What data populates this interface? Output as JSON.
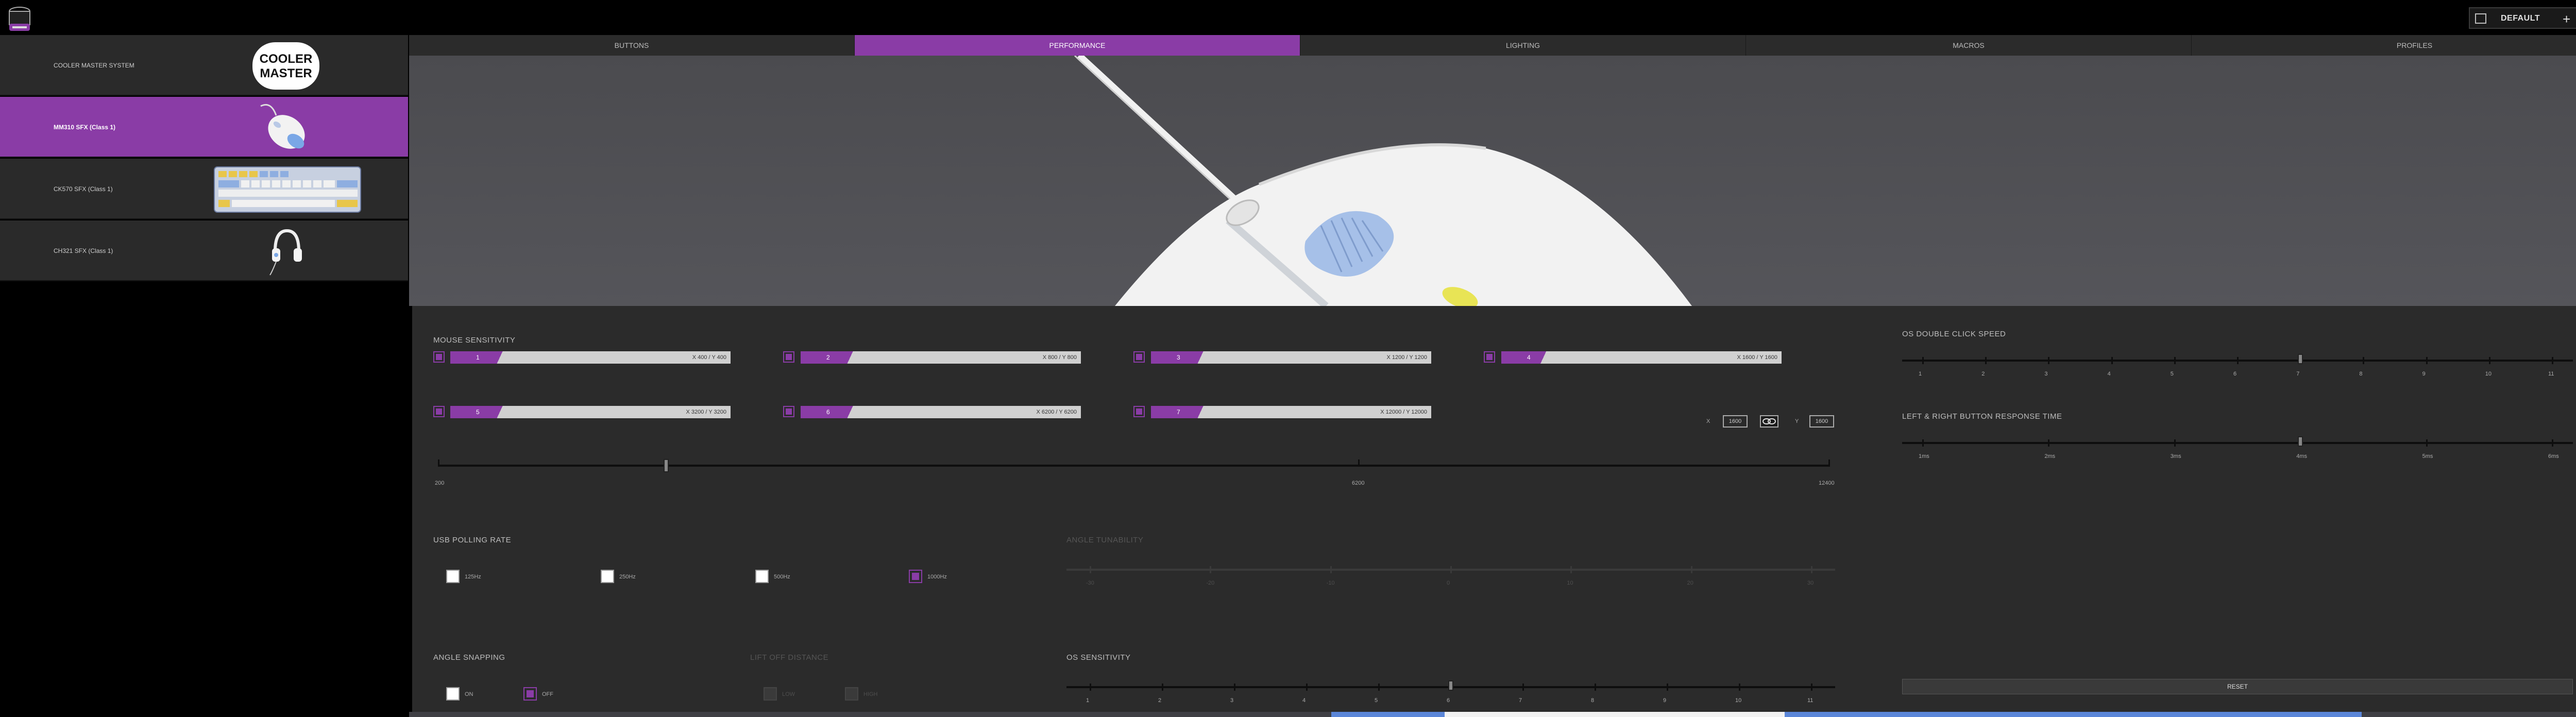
{
  "app": {
    "profile": {
      "label": "DEFAULT"
    },
    "window_buttons": [
      "–",
      "□",
      "×"
    ],
    "close_extra": "✕"
  },
  "sidebar": {
    "items": [
      {
        "label": "COOLER MASTER SYSTEM",
        "logo_text": "COOLER MASTER",
        "active": false
      },
      {
        "label": "MM310 SFX (Class 1)",
        "active": true
      },
      {
        "label": "CK570 SFX (Class 1)",
        "active": false
      },
      {
        "label": "CH321 SFX (Class 1)",
        "active": false
      }
    ]
  },
  "tabs": [
    "BUTTONS",
    "PERFORMANCE",
    "LIGHTING",
    "MACROS",
    "PROFILES"
  ],
  "active_tab": "PERFORMANCE",
  "performance": {
    "mouse_sensitivity": {
      "title": "MOUSE SENSITIVITY",
      "stages": [
        {
          "n": "1",
          "value": "X 400 / Y 400"
        },
        {
          "n": "2",
          "value": "X 800 / Y 800"
        },
        {
          "n": "3",
          "value": "X 1200 / Y 1200"
        },
        {
          "n": "4",
          "value": "X 1600 / Y 1600"
        },
        {
          "n": "5",
          "value": "X 3200 / Y 3200"
        },
        {
          "n": "6",
          "value": "X 6200 / Y 6200"
        },
        {
          "n": "7",
          "value": "X 12000 / Y 12000"
        }
      ],
      "x_label": "X",
      "x_value": "1600",
      "y_label": "Y",
      "y_value": "1600",
      "slider_min": "200",
      "slider_mid": "6200",
      "slider_max": "12400",
      "slider_value": 1600
    },
    "usb_polling": {
      "title": "USB POLLING RATE",
      "options": [
        "125Hz",
        "250Hz",
        "500Hz",
        "1000Hz"
      ],
      "selected": "1000Hz"
    },
    "angle_tunability": {
      "title": "ANGLE TUNABILITY",
      "labels": [
        "-30",
        "-20",
        "-10",
        "0",
        "10",
        "20",
        "30"
      ]
    },
    "angle_snapping": {
      "title": "ANGLE SNAPPING",
      "options": [
        "ON",
        "OFF"
      ],
      "selected": "OFF"
    },
    "lift_off": {
      "title": "LIFT OFF DISTANCE",
      "options": [
        "LOW",
        "HIGH"
      ]
    },
    "os_sensitivity": {
      "title": "OS SENSITIVITY",
      "labels": [
        "1",
        "2",
        "3",
        "4",
        "5",
        "6",
        "7",
        "8",
        "9",
        "10",
        "11"
      ],
      "value": 6
    },
    "os_double_click": {
      "title": "OS DOUBLE CLICK SPEED",
      "labels": [
        "1",
        "2",
        "3",
        "4",
        "5",
        "6",
        "7",
        "8",
        "9",
        "10",
        "11"
      ],
      "value": 7
    },
    "response_time": {
      "title": "LEFT & RIGHT BUTTON RESPONSE TIME",
      "labels": [
        "1ms",
        "2ms",
        "3ms",
        "4ms",
        "5ms",
        "6ms"
      ],
      "value": "4ms"
    },
    "reset_label": "RESET"
  },
  "colors": {
    "accent": "#8a3ca6",
    "panel": "#2b2b2b",
    "sidebar": "#2a2a2a"
  }
}
